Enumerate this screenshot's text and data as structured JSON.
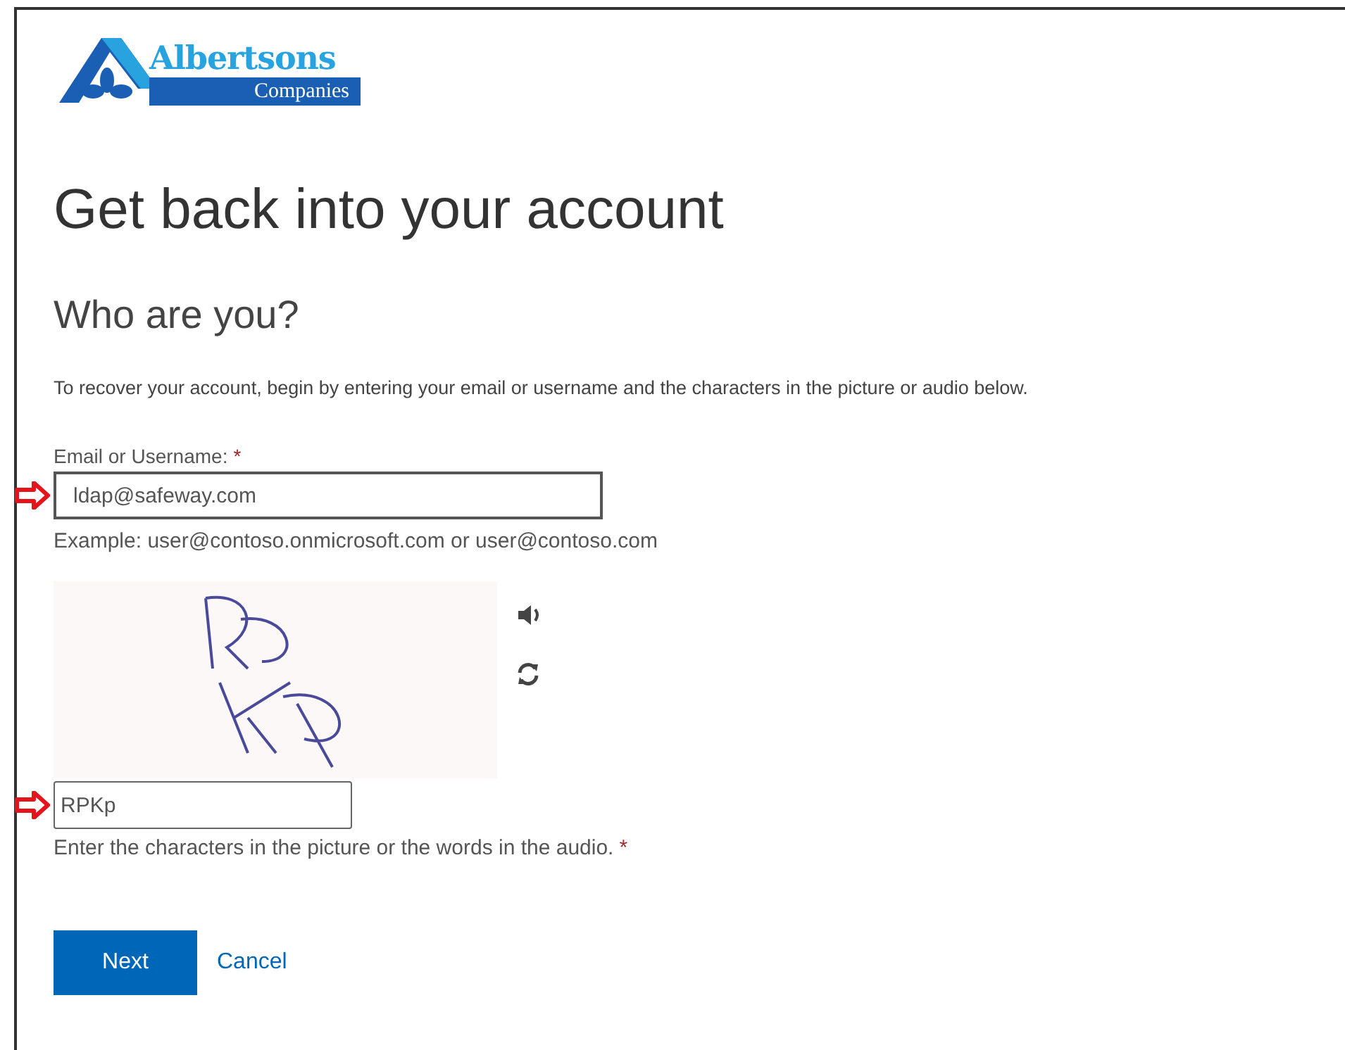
{
  "logo": {
    "name": "Albertsons",
    "subname": "Companies"
  },
  "heading": "Get back into your account",
  "subheading": "Who are you?",
  "description": "To recover your account, begin by entering your email or username and the characters in the picture or audio below.",
  "email_field": {
    "label": "Email or Username:",
    "required_mark": "*",
    "value": "ldap@safeway.com",
    "arrow_marker": true
  },
  "example": "Example: user@contoso.onmicrosoft.com or user@contoso.com",
  "captcha_field": {
    "value": "RPKp",
    "arrow_marker": true
  },
  "captcha_help": {
    "text": "Enter the characters in the picture or the words in the audio.",
    "required_mark": "*"
  },
  "buttons": [
    {
      "label": "Next",
      "kind": "primary"
    },
    {
      "label": "Cancel",
      "kind": "link"
    }
  ]
}
